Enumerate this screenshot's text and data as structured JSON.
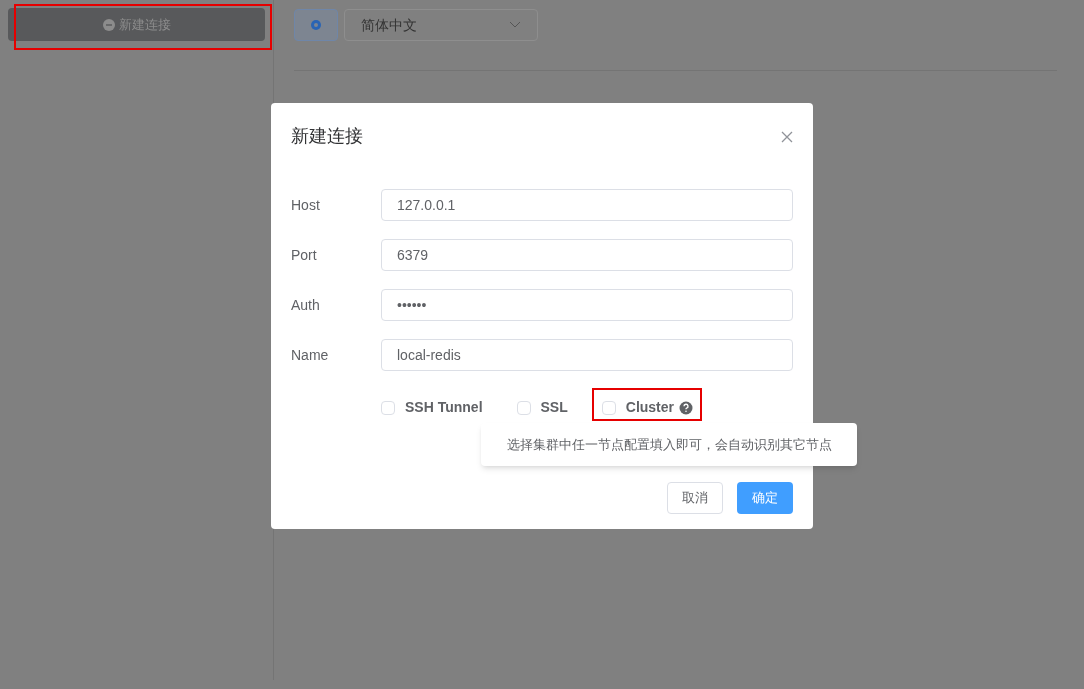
{
  "sidebar": {
    "new_connection_button": "新建连接"
  },
  "toolbar": {
    "language_select": "简体中文"
  },
  "dialog": {
    "title": "新建连接",
    "fields": [
      {
        "label": "Host",
        "value": "127.0.0.1"
      },
      {
        "label": "Port",
        "value": "6379"
      },
      {
        "label": "Auth",
        "value": "••••••"
      },
      {
        "label": "Name",
        "value": "local-redis"
      }
    ],
    "options": [
      {
        "label": "SSH Tunnel",
        "checked": false,
        "help": false
      },
      {
        "label": "SSL",
        "checked": false,
        "help": false
      },
      {
        "label": "Cluster",
        "checked": false,
        "help": true
      }
    ],
    "tooltip": "选择集群中任一节点配置填入即可，会自动识别其它节点",
    "buttons": [
      {
        "label": "取消",
        "kind": "secondary"
      },
      {
        "label": "确定",
        "kind": "primary"
      }
    ]
  }
}
